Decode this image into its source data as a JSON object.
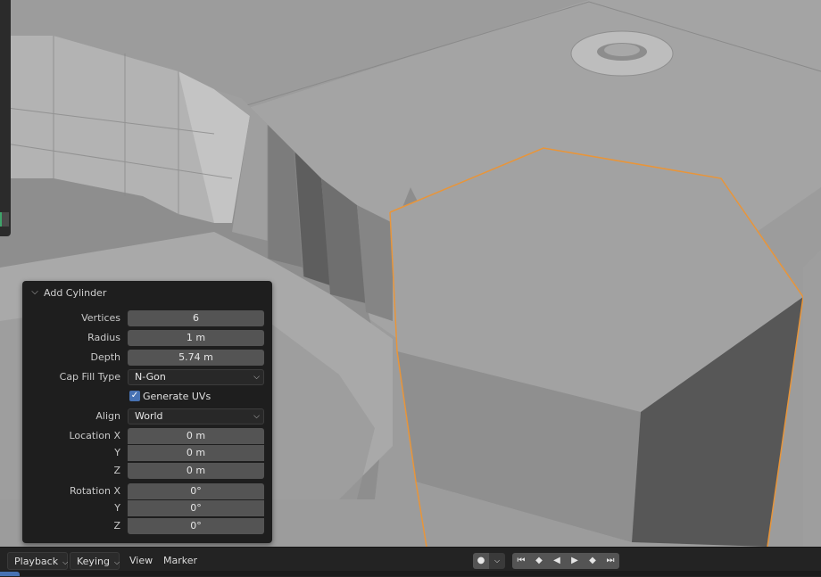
{
  "operator_panel": {
    "title": "Add Cylinder",
    "fields": {
      "vertices": {
        "label": "Vertices",
        "value": "6"
      },
      "radius": {
        "label": "Radius",
        "value": "1 m"
      },
      "depth": {
        "label": "Depth",
        "value": "5.74 m"
      },
      "cap_fill_type": {
        "label": "Cap Fill Type",
        "value": "N-Gon"
      },
      "generate_uvs": {
        "label": "Generate UVs",
        "checked": true
      },
      "align": {
        "label": "Align",
        "value": "World"
      },
      "location_x": {
        "label": "Location X",
        "value": "0 m"
      },
      "location_y": {
        "label": "Y",
        "value": "0 m"
      },
      "location_z": {
        "label": "Z",
        "value": "0 m"
      },
      "rotation_x": {
        "label": "Rotation X",
        "value": "0°"
      },
      "rotation_y": {
        "label": "Y",
        "value": "0°"
      },
      "rotation_z": {
        "label": "Z",
        "value": "0°"
      }
    }
  },
  "timeline": {
    "playback": "Playback",
    "keying": "Keying",
    "view": "View",
    "marker": "Marker"
  },
  "icons": {
    "check": "✓",
    "chevron_down": "⌵",
    "record": "●",
    "jump_start": "⏮",
    "prev_key": "◆",
    "play_reverse": "◀",
    "play": "▶",
    "next_key": "◆",
    "jump_end": "⏭"
  },
  "colors": {
    "selection_outline": "#e8953a",
    "accent_blue": "#4772b3"
  }
}
